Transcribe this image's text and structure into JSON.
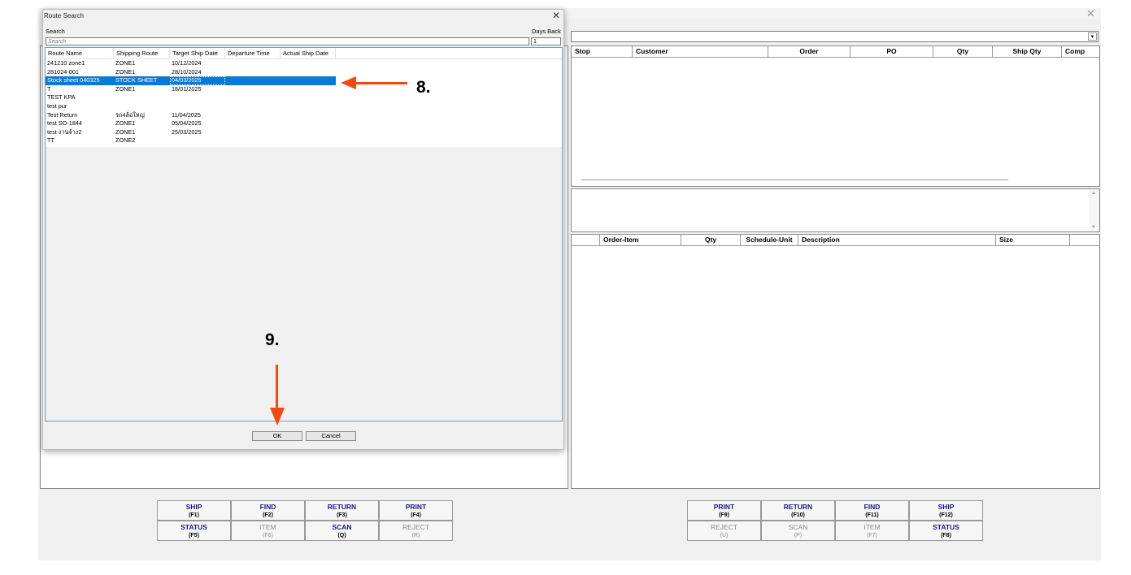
{
  "app": {
    "close_glyph": "✕"
  },
  "dialog": {
    "title": "Route Search",
    "close_glyph": "✕",
    "search_label": "Search",
    "search_placeholder": "Search",
    "search_value": "",
    "days_back_label": "Days Back",
    "days_back_value": "1",
    "columns": [
      "Route Name",
      "Shipping Route",
      "Target Ship Date",
      "Departure Time",
      "Actual Ship Date"
    ],
    "rows": [
      {
        "name": "241210 zone1",
        "route": "ZONE1",
        "target": "10/12/2024",
        "departure": "",
        "actual": ""
      },
      {
        "name": "281024-001",
        "route": "ZONE1",
        "target": "28/10/2024",
        "departure": "",
        "actual": ""
      },
      {
        "name": "Stock sheet 040325",
        "route": "STOCK SHEET",
        "target": "04/03/2025",
        "departure": "",
        "actual": "",
        "selected": true
      },
      {
        "name": "T",
        "route": "ZONE1",
        "target": "18/01/2025",
        "departure": "",
        "actual": ""
      },
      {
        "name": "TEST KPA",
        "route": "",
        "target": "",
        "departure": "",
        "actual": ""
      },
      {
        "name": "test pur",
        "route": "",
        "target": "",
        "departure": "",
        "actual": ""
      },
      {
        "name": "Test Return",
        "route": "รถ4ล้อใหญ่",
        "target": "11/04/2025",
        "departure": "",
        "actual": ""
      },
      {
        "name": "test SO-1844",
        "route": "ZONE1",
        "target": "05/04/2025",
        "departure": "",
        "actual": ""
      },
      {
        "name": "test งานจ้าง2",
        "route": "ZONE1",
        "target": "25/03/2025",
        "departure": "",
        "actual": ""
      },
      {
        "name": "TT",
        "route": "ZONE2",
        "target": "",
        "departure": "",
        "actual": ""
      }
    ],
    "ok_label": "OK",
    "cancel_label": "Cancel"
  },
  "annotations": {
    "step8": "8.",
    "step9": "9.",
    "color": "#f04a12"
  },
  "right_panel": {
    "combo_value": "",
    "combo_arrow": "▾",
    "stops_columns": [
      "Stop",
      "Customer",
      "Order",
      "PO",
      "Qty",
      "Ship Qty",
      "Comp"
    ],
    "memo_scroll_up": "▲",
    "memo_scroll_down": "▼",
    "items_columns": [
      "",
      "Order-Item",
      "Qty",
      "Schedule-Unit",
      "Description",
      "Size",
      ""
    ]
  },
  "function_keys_left": [
    {
      "label": "SHIP",
      "key": "(F1)",
      "enabled": true
    },
    {
      "label": "FIND",
      "key": "(F2)",
      "enabled": true
    },
    {
      "label": "RETURN",
      "key": "(F3)",
      "enabled": true
    },
    {
      "label": "PRINT",
      "key": "(F4)",
      "enabled": true
    },
    {
      "label": "STATUS",
      "key": "(F5)",
      "enabled": true
    },
    {
      "label": "ITEM",
      "key": "(F6)",
      "enabled": false
    },
    {
      "label": "SCAN",
      "key": "(Q)",
      "enabled": true
    },
    {
      "label": "REJECT",
      "key": "(R)",
      "enabled": false
    }
  ],
  "function_keys_right": [
    {
      "label": "PRINT",
      "key": "(F9)",
      "enabled": true
    },
    {
      "label": "RETURN",
      "key": "(F10)",
      "enabled": true
    },
    {
      "label": "FIND",
      "key": "(F11)",
      "enabled": true
    },
    {
      "label": "SHIP",
      "key": "(F12)",
      "enabled": true
    },
    {
      "label": "REJECT",
      "key": "(U)",
      "enabled": false
    },
    {
      "label": "SCAN",
      "key": "(P)",
      "enabled": false
    },
    {
      "label": "ITEM",
      "key": "(F7)",
      "enabled": false
    },
    {
      "label": "STATUS",
      "key": "(F8)",
      "enabled": true
    }
  ]
}
